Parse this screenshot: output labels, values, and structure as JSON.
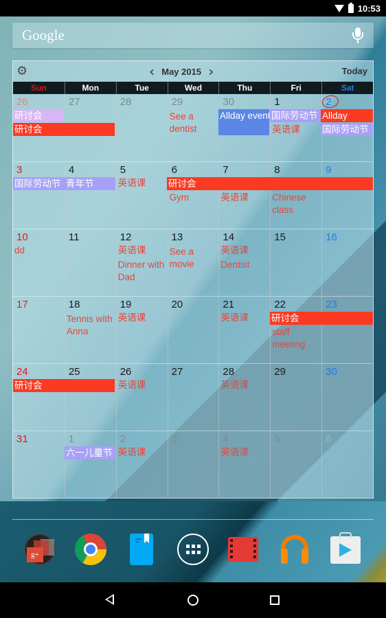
{
  "status_bar": {
    "time": "10:53",
    "icons": [
      "wifi-icon",
      "battery-icon"
    ]
  },
  "search": {
    "logo": "Google",
    "icon": "mic-icon"
  },
  "calendar": {
    "month_label": "May 2015",
    "prev_icon": "‹",
    "next_icon": "›",
    "today_label": "Today",
    "settings_icon": "⚙",
    "weekdays": [
      "Sun",
      "Mon",
      "Tue",
      "Wed",
      "Thu",
      "Fri",
      "Sat"
    ],
    "weeks": [
      {
        "days": [
          "26",
          "27",
          "28",
          "29",
          "30",
          "1",
          "2"
        ]
      },
      {
        "days": [
          "3",
          "4",
          "5",
          "6",
          "7",
          "8",
          "9"
        ]
      },
      {
        "days": [
          "10",
          "11",
          "12",
          "13",
          "14",
          "15",
          "16"
        ]
      },
      {
        "days": [
          "17",
          "18",
          "19",
          "20",
          "21",
          "22",
          "23"
        ]
      },
      {
        "days": [
          "24",
          "25",
          "26",
          "27",
          "28",
          "29",
          "30"
        ]
      },
      {
        "days": [
          "31",
          "1",
          "2",
          "3",
          "4",
          "5",
          "6"
        ]
      }
    ],
    "today": "2",
    "events": {
      "w0_sun_bar": "研讨会",
      "w0_sunmon_bar": "研讨会",
      "w0_wed_text": "See a dentist",
      "w0_thu_bar": "Allday event",
      "w0_fri_bar": "国际劳动节",
      "w0_fri_text": "英语课",
      "w0_sat_bar1": "Allday",
      "w0_sat_bar2": "国际劳动节",
      "w1_sun_bar": "国际劳动节",
      "w1_mon_bar": "青年节",
      "w1_tue_text": "英语课",
      "w1_wed_sat_bar": "研讨会",
      "w1_wed_text": "Gym",
      "w1_thu_text": "英语课",
      "w1_fri_text": "Chinese class",
      "w2_sun_text": "dd",
      "w2_tue_text1": "英语课",
      "w2_tue_text2": "Dinner with Dad",
      "w2_wed_text": "See a movie",
      "w2_thu_text1": "英语课",
      "w2_thu_text2": "Dentist",
      "w3_mon_text": "Tennis with Anna",
      "w3_tue_text": "英语课",
      "w3_thu_text": "英语课",
      "w3_fri_sat_bar": "研讨会",
      "w3_fri_text": "staff meeting",
      "w4_sunmon_bar": "研讨会",
      "w4_tue_text": "英语课",
      "w4_thu_text": "英语课",
      "w5_mon_bar": "六一儿童节",
      "w5_tue_text": "英语课",
      "w5_thu_text": "英语课"
    },
    "colors": {
      "red_event": "#fa3a22",
      "holiday_event": "#a8a0f6",
      "pink_event": "#d9b4f7",
      "blue_event": "#5b86e6",
      "text_event": "#e8453a",
      "sunday": "#e8141c",
      "saturday": "#1d7fe6"
    }
  },
  "dock": {
    "apps": [
      {
        "name": "Google+",
        "icon": "google-plus-icon",
        "glyph": "g+"
      },
      {
        "name": "Chrome",
        "icon": "chrome-icon"
      },
      {
        "name": "Play Books",
        "icon": "play-books-icon"
      },
      {
        "name": "App drawer",
        "icon": "app-drawer-icon"
      },
      {
        "name": "Play Movies",
        "icon": "play-movies-icon"
      },
      {
        "name": "Play Music",
        "icon": "play-music-icon"
      },
      {
        "name": "Play Store",
        "icon": "play-store-icon"
      }
    ]
  },
  "nav": {
    "back": "back-icon",
    "home": "home-icon",
    "recents": "recents-icon"
  }
}
